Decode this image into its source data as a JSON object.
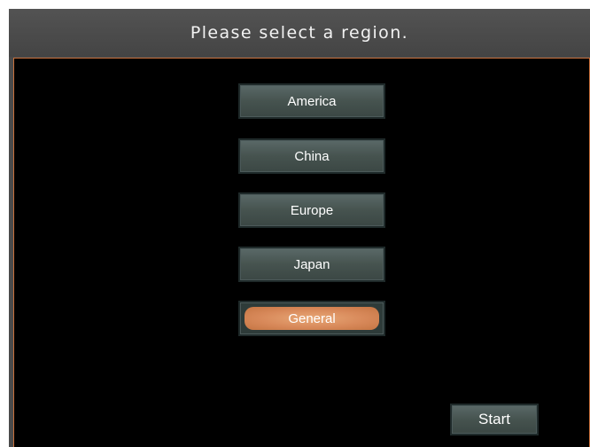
{
  "title": "Please select a region.",
  "regions": [
    {
      "label": "America",
      "selected": false
    },
    {
      "label": "China",
      "selected": false
    },
    {
      "label": "Europe",
      "selected": false
    },
    {
      "label": "Japan",
      "selected": false
    },
    {
      "label": "General",
      "selected": true
    }
  ],
  "start_label": "Start",
  "colors": {
    "accent": "#c8703c",
    "selected_fill": "#d8895a",
    "button": "#46534f",
    "background": "#000000",
    "title_bar": "#4a4a4a"
  }
}
